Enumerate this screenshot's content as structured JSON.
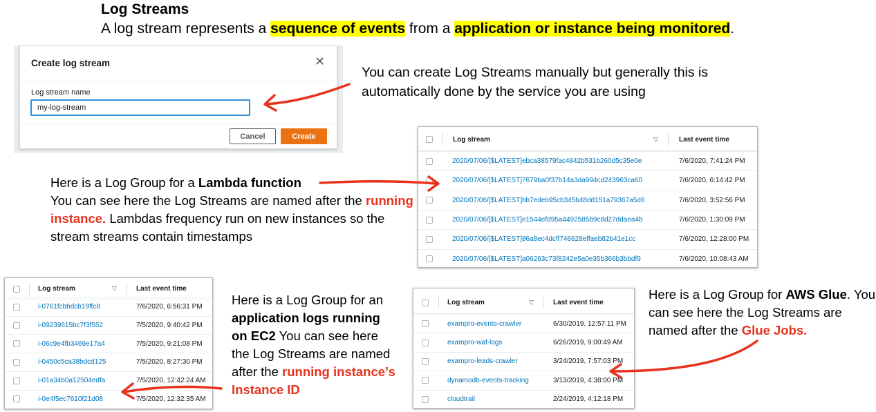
{
  "heading": {
    "title": "Log Streams",
    "subtitle_prefix": "A log stream represents a ",
    "subtitle_hl1": "sequence of events",
    "subtitle_mid": " from a ",
    "subtitle_hl2": "application or instance being monitored",
    "subtitle_suffix": "."
  },
  "modal": {
    "title": "Create log stream",
    "close_glyph": "✕",
    "field_label": "Log stream name",
    "field_value": "my-log-stream",
    "cancel_label": "Cancel",
    "create_label": "Create"
  },
  "notes": {
    "manual": "You can create Log Streams manually but generally this is automatically done by the service you are using",
    "lambda_1": "Here is a Log Group for a ",
    "lambda_bold": "Lambda function",
    "lambda_2": "You can see here the Log Streams are named after the ",
    "lambda_red": "running instance.",
    "lambda_3": " Lambdas frequency run on new instances so the stream streams contain timestamps",
    "ec2_1": "Here is a Log Group for an ",
    "ec2_bold": "application logs running on EC2",
    "ec2_2": " You can see here the Log Streams are named after the ",
    "ec2_red": "running instance’s Instance ID",
    "glue_1": "Here is a Log Group for ",
    "glue_bold": "AWS Glue",
    "glue_2": ". You can see here the Log Streams are named after the ",
    "glue_red": "Glue Jobs."
  },
  "table_headers": {
    "log_stream": "Log stream",
    "last_event_time": "Last event time",
    "sort_glyph": "▽"
  },
  "lambda_rows": [
    {
      "name": "2020/07/06/[$LATEST]ebca38579fac4842b531b260d5c35e0e",
      "time": "7/6/2020, 7:41:24 PM"
    },
    {
      "name": "2020/07/06/[$LATEST]7679ba0f37b14a3da994cd243963ca60",
      "time": "7/6/2020, 6:14:42 PM"
    },
    {
      "name": "2020/07/06/[$LATEST]bb7edeb95cb345b48dd151a79367a5d6",
      "time": "7/6/2020, 3:52:56 PM"
    },
    {
      "name": "2020/07/06/[$LATEST]e1544efd95a4492585b9c8d27ddaea4b",
      "time": "7/6/2020, 1:30:09 PM"
    },
    {
      "name": "2020/07/06/[$LATEST]86a8ec4dcff746628effaeb82b41e1cc",
      "time": "7/6/2020, 12:28:00 PM"
    },
    {
      "name": "2020/07/06/[$LATEST]a06263c73f8242e5a0e35b366b3bbdf9",
      "time": "7/6/2020, 10:08:43 AM"
    }
  ],
  "ec2_rows": [
    {
      "name": "i-0761fcbbdcb19ffc8",
      "time": "7/6/2020, 6:56:31 PM"
    },
    {
      "name": "i-09239615bc7f3f552",
      "time": "7/5/2020, 9:40:42 PM"
    },
    {
      "name": "i-06c9e4fb3469e17a4",
      "time": "7/5/2020, 9:21:08 PM"
    },
    {
      "name": "i-0450c5ca38bdcd125",
      "time": "7/5/2020, 8:27:30 PM"
    },
    {
      "name": "i-01a34b0a12504edfa",
      "time": "7/5/2020, 12:42:24 AM"
    },
    {
      "name": "i-0e4f5ec7610f21d08",
      "time": "7/5/2020, 12:32:35 AM"
    }
  ],
  "glue_rows": [
    {
      "name": "exampro-events-crawler",
      "time": "6/30/2019, 12:57:11 PM"
    },
    {
      "name": "exampro-waf-logs",
      "time": "6/26/2019, 9:00:49 AM"
    },
    {
      "name": "exampro-leads-crawler",
      "time": "3/24/2019, 7:57:03 PM"
    },
    {
      "name": "dynamodb-events-tracking",
      "time": "3/13/2019, 4:38:00 PM"
    },
    {
      "name": "cloudtrail",
      "time": "2/24/2019, 4:12:18 PM"
    }
  ],
  "colors": {
    "highlight": "#ffff00",
    "annotation_red": "#e8321e",
    "link_blue": "#0073bb",
    "primary_orange": "#ec7211"
  }
}
